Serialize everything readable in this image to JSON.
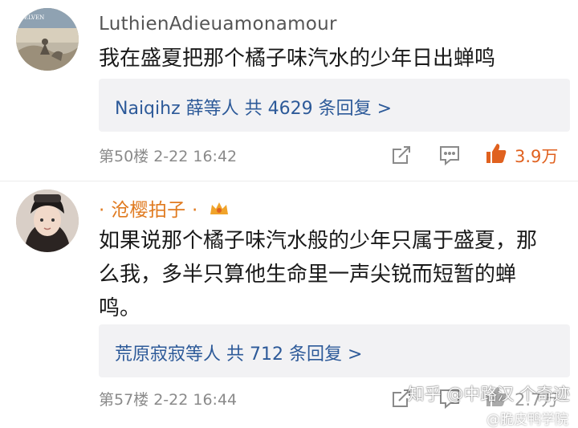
{
  "comments": [
    {
      "username": "LuthienAdieuamonamour",
      "text": "我在盛夏把那个橘子味汽水的少年日出蝉鸣",
      "reply_summary": "Naiqihz 薛等人  共 4629 条回复 >",
      "floor_time": "第50楼  2-22 16:42",
      "likes": "3.9万",
      "avatar_icon": "landscape-avatar-icon"
    },
    {
      "username": "· 沧樱拍子 ·",
      "text_line1": "如果说那个橘子味汽水般的少年只属于盛夏，那",
      "text_line2": "么我，多半只算他生命里一声尖锐而短暂的蝉",
      "text_line3": "鸣。",
      "reply_summary": "荒原寂寂等人  共 712 条回复 >",
      "floor_time": "第57楼  2-22 16:44",
      "likes": "2.7万",
      "avatar_icon": "girl-portrait-avatar-icon"
    }
  ],
  "watermark": "知乎 @中路汉 个奇迹",
  "watermark_sub": "@脆皮鸭学院",
  "colors": {
    "accent_orange": "#e0611f",
    "link_blue": "#2d5a99"
  }
}
